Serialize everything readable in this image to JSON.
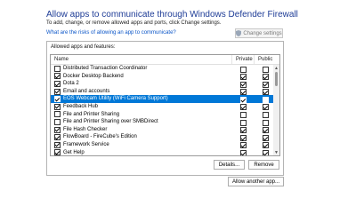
{
  "header": {
    "title": "Allow apps to communicate through Windows Defender Firewall",
    "subtitle": "To add, change, or remove allowed apps and ports, click Change settings.",
    "risk_link": "What are the risks of allowing an app to communicate?",
    "change_settings": "Change settings"
  },
  "panel": {
    "label": "Allowed apps and features:",
    "columns": {
      "name": "Name",
      "private": "Private",
      "public": "Public"
    },
    "rows": [
      {
        "name": "Distributed Transaction Coordinator",
        "enabled": false,
        "private": false,
        "public": false
      },
      {
        "name": "Docker Desktop Backend",
        "enabled": true,
        "private": true,
        "public": true
      },
      {
        "name": "Dota 2",
        "enabled": true,
        "private": true,
        "public": true
      },
      {
        "name": "Email and accounts",
        "enabled": true,
        "private": true,
        "public": true
      },
      {
        "name": "EOS Webcam Utility (WiFi Camera Support)",
        "enabled": true,
        "private": true,
        "public": false,
        "selected": true
      },
      {
        "name": "Feedback Hub",
        "enabled": true,
        "private": true,
        "public": true
      },
      {
        "name": "File and Printer Sharing",
        "enabled": false,
        "private": false,
        "public": false
      },
      {
        "name": "File and Printer Sharing over SMBDirect",
        "enabled": false,
        "private": false,
        "public": false
      },
      {
        "name": "File Hash Checker",
        "enabled": true,
        "private": true,
        "public": true
      },
      {
        "name": "FlowBoard - FireCube's Edition",
        "enabled": true,
        "private": true,
        "public": true
      },
      {
        "name": "Framework Service",
        "enabled": true,
        "private": true,
        "public": true
      },
      {
        "name": "Get Help",
        "enabled": true,
        "private": true,
        "public": true
      }
    ],
    "details_button": "Details...",
    "remove_button": "Remove"
  },
  "allow_another_button": "Allow another app...",
  "colors": {
    "selected": "#0078d7",
    "title": "#1e3c96",
    "link": "#0a55c8"
  }
}
